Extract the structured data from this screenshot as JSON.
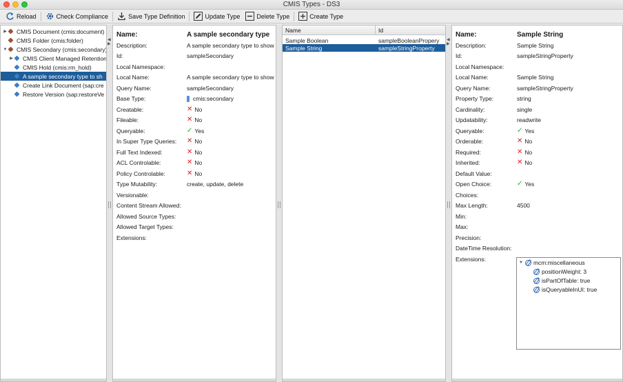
{
  "window": {
    "title": "CMIS Types - DS3"
  },
  "toolbar": {
    "reload": "Reload",
    "check_compliance": "Check Compliance",
    "save_type_definition": "Save Type Definition",
    "update_type": "Update Type",
    "delete_type": "Delete Type",
    "create_type": "Create Type"
  },
  "tree": {
    "items": [
      {
        "label": "CMIS Document (cmis:document)",
        "toggle": "▶"
      },
      {
        "label": "CMIS Folder (cmis:folder)",
        "toggle": ""
      },
      {
        "label": "CMIS Secondary (cmis:secondary)",
        "toggle": "▼"
      },
      {
        "label": "CMIS Client Managed Retention",
        "toggle": "▶"
      },
      {
        "label": "CMIS Hold (cmis:rm_hold)",
        "toggle": ""
      },
      {
        "label": "A sample secondary type to sh",
        "toggle": ""
      },
      {
        "label": "Create Link Document (sap:cre",
        "toggle": ""
      },
      {
        "label": "Restore Version (sap:restoreVe",
        "toggle": ""
      }
    ]
  },
  "type_details": {
    "rows": [
      {
        "label": "Name:",
        "value": "A sample secondary type",
        "mark": "bold"
      },
      {
        "label": "Description:",
        "value": "A sample secondary type to show",
        "mark": ""
      },
      {
        "label": "Id:",
        "value": "sampleSecondary",
        "mark": ""
      },
      {
        "label": "Local Namespace:",
        "value": "",
        "mark": ""
      },
      {
        "label": "Local Name:",
        "value": "A sample secondary type to show",
        "mark": ""
      },
      {
        "label": "Query Name:",
        "value": "sampleSecondary",
        "mark": ""
      },
      {
        "label": "Base Type:",
        "value": "cmis:secondary",
        "mark": "pin"
      },
      {
        "label": "Creatable:",
        "value": "No",
        "mark": "x"
      },
      {
        "label": "Fileable:",
        "value": "No",
        "mark": "x"
      },
      {
        "label": "Queryable:",
        "value": "Yes",
        "mark": "check"
      },
      {
        "label": "In Super Type Queries:",
        "value": "No",
        "mark": "x"
      },
      {
        "label": "Full Text Indexed:",
        "value": "No",
        "mark": "x"
      },
      {
        "label": "ACL Controlable:",
        "value": "No",
        "mark": "x"
      },
      {
        "label": "Policy Controlable:",
        "value": "No",
        "mark": "x"
      },
      {
        "label": "Type Mutability:",
        "value": "create, update, delete",
        "mark": ""
      },
      {
        "label": "Versionable:",
        "value": "",
        "mark": ""
      },
      {
        "label": "Content Stream Allowed:",
        "value": "",
        "mark": ""
      },
      {
        "label": "Allowed Source Types:",
        "value": "",
        "mark": ""
      },
      {
        "label": "Allowed Target Types:",
        "value": "",
        "mark": ""
      },
      {
        "label": "Extensions:",
        "value": "",
        "mark": ""
      }
    ]
  },
  "properties_table": {
    "columns": [
      "Name",
      "Id"
    ],
    "rows": [
      {
        "name": "Sample Boolean",
        "id": "sampleBooleanPropery"
      },
      {
        "name": "Sample String",
        "id": "sampleStringProperty"
      }
    ]
  },
  "property_details": {
    "rows": [
      {
        "label": "Name:",
        "value": "Sample String",
        "mark": "bold"
      },
      {
        "label": "Description:",
        "value": "Sample String",
        "mark": ""
      },
      {
        "label": "Id:",
        "value": "sampleStringProperty",
        "mark": ""
      },
      {
        "label": "Local Namespace:",
        "value": "",
        "mark": ""
      },
      {
        "label": "Local Name:",
        "value": "Sample String",
        "mark": ""
      },
      {
        "label": "Query Name:",
        "value": "sampleStringProperty",
        "mark": ""
      },
      {
        "label": "Property Type:",
        "value": "string",
        "mark": ""
      },
      {
        "label": "Cardinality:",
        "value": "single",
        "mark": ""
      },
      {
        "label": "Updatability:",
        "value": "readwrite",
        "mark": ""
      },
      {
        "label": "Queryable:",
        "value": "Yes",
        "mark": "check"
      },
      {
        "label": "Orderable:",
        "value": "No",
        "mark": "x"
      },
      {
        "label": "Required:",
        "value": "No",
        "mark": "x"
      },
      {
        "label": "Inherited:",
        "value": "No",
        "mark": "x"
      },
      {
        "label": "Default Value:",
        "value": "",
        "mark": ""
      },
      {
        "label": "Open Choice:",
        "value": "Yes",
        "mark": "check"
      },
      {
        "label": "Choices:",
        "value": "",
        "mark": ""
      },
      {
        "label": "Max Length:",
        "value": "4500",
        "mark": ""
      },
      {
        "label": "Min:",
        "value": "",
        "mark": ""
      },
      {
        "label": "Max:",
        "value": "",
        "mark": ""
      },
      {
        "label": "Precision:",
        "value": "",
        "mark": ""
      },
      {
        "label": "DateTime Resolution:",
        "value": "",
        "mark": ""
      },
      {
        "label": "Extensions:",
        "value": "",
        "mark": ""
      }
    ],
    "extensions": {
      "root": "mcm:miscellaneous",
      "children": [
        "positionWeight: 3",
        "isPartOfTable: true",
        "isQueryableInUI: true"
      ]
    }
  }
}
